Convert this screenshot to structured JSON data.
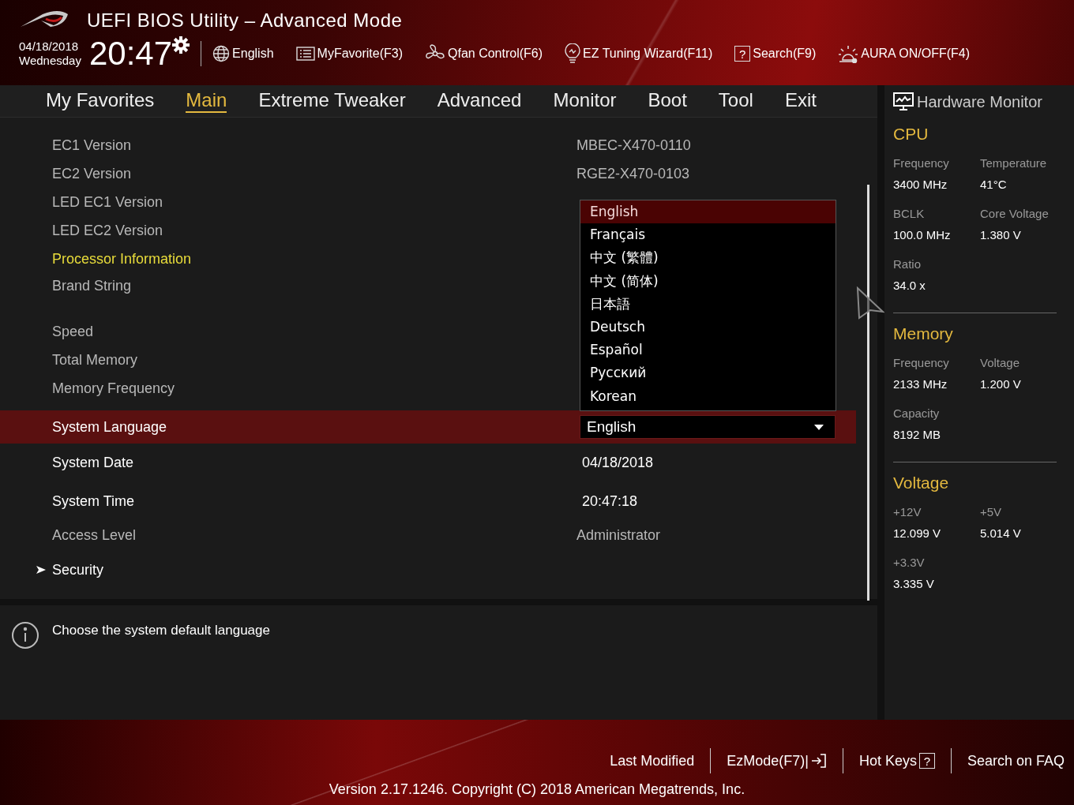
{
  "header": {
    "title": "UEFI BIOS Utility – Advanced Mode",
    "date": "04/18/2018",
    "weekday": "Wednesday",
    "time": "20:47",
    "toolbar": [
      {
        "kind": "language",
        "label": "English"
      },
      {
        "kind": "favorite",
        "label": "MyFavorite(F3)"
      },
      {
        "kind": "fan",
        "label": "Qfan Control(F6)"
      },
      {
        "kind": "wizard",
        "label": "EZ Tuning Wizard(F11)"
      },
      {
        "kind": "search",
        "mark": "?",
        "label": "Search(F9)"
      },
      {
        "kind": "aura",
        "label": "AURA ON/OFF(F4)"
      }
    ]
  },
  "tabs": [
    {
      "label": "My Favorites",
      "selected": false
    },
    {
      "label": "Main",
      "selected": true
    },
    {
      "label": "Extreme Tweaker",
      "selected": false
    },
    {
      "label": "Advanced",
      "selected": false
    },
    {
      "label": "Monitor",
      "selected": false
    },
    {
      "label": "Boot",
      "selected": false
    },
    {
      "label": "Tool",
      "selected": false
    },
    {
      "label": "Exit",
      "selected": false
    }
  ],
  "rows": [
    {
      "kind": "info",
      "label": "EC1 Version",
      "value": "MBEC-X470-0110",
      "selected": false
    },
    {
      "kind": "info",
      "label": "EC2 Version",
      "value": "RGE2-X470-0103",
      "selected": false
    },
    {
      "kind": "info",
      "label": "LED EC1 Version",
      "selected": false
    },
    {
      "kind": "info",
      "label": "LED EC2 Version",
      "selected": false
    },
    {
      "kind": "heading",
      "label": "Processor Information",
      "selected": false
    },
    {
      "kind": "info",
      "label": "Brand String",
      "selected": false
    },
    {
      "kind": "info",
      "label": "Speed",
      "selected": false
    },
    {
      "kind": "info",
      "label": "Total Memory",
      "selected": false
    },
    {
      "kind": "info",
      "label": "Memory Frequency",
      "selected": false
    },
    {
      "kind": "select",
      "label": "System Language",
      "value": "English",
      "selected": true
    },
    {
      "kind": "editable",
      "label": "System Date",
      "value": "04/18/2018",
      "selected": false
    },
    {
      "kind": "editable",
      "label": "System Time",
      "value": "20:47:18",
      "selected": false
    },
    {
      "kind": "info",
      "label": "Access Level",
      "value": "Administrator",
      "selected": false
    },
    {
      "kind": "submenu",
      "label": "Security",
      "selected": false
    }
  ],
  "dropdown": [
    {
      "label": "English",
      "selected": true
    },
    {
      "label": "Français",
      "selected": false
    },
    {
      "label": "中文 (繁體)",
      "selected": false
    },
    {
      "label": "中文 (简体)",
      "selected": false
    },
    {
      "label": "日本語",
      "selected": false
    },
    {
      "label": "Deutsch",
      "selected": false
    },
    {
      "label": "Español",
      "selected": false
    },
    {
      "label": "Русский",
      "selected": false
    },
    {
      "label": "Korean",
      "selected": false
    }
  ],
  "help": "Choose the system default language",
  "hardware_monitor": {
    "title": "Hardware Monitor",
    "sections": [
      {
        "title": "CPU",
        "items": [
          {
            "label": "Frequency",
            "value": "3400 MHz"
          },
          {
            "label": "Temperature",
            "value": "41°C"
          },
          {
            "label": "BCLK",
            "value": "100.0 MHz"
          },
          {
            "label": "Core Voltage",
            "value": "1.380 V"
          },
          {
            "label": "Ratio",
            "value": "34.0 x"
          }
        ]
      },
      {
        "title": "Memory",
        "items": [
          {
            "label": "Frequency",
            "value": "2133 MHz"
          },
          {
            "label": "Voltage",
            "value": "1.200 V"
          },
          {
            "label": "Capacity",
            "value": "8192 MB"
          }
        ]
      },
      {
        "title": "Voltage",
        "items": [
          {
            "label": "+12V",
            "value": "12.099 V"
          },
          {
            "label": "+5V",
            "value": "5.014 V"
          },
          {
            "label": "+3.3V",
            "value": "3.335 V"
          }
        ]
      }
    ]
  },
  "footer": {
    "links": [
      {
        "kind": "plain",
        "label": "Last Modified"
      },
      {
        "kind": "exit",
        "label": "EzMode(F7)|"
      },
      {
        "kind": "help",
        "label": "Hot Keys",
        "mark": "?"
      },
      {
        "kind": "plain",
        "label": "Search on FAQ"
      }
    ],
    "version": "Version 2.17.1246. Copyright (C) 2018 American Megatrends, Inc."
  }
}
